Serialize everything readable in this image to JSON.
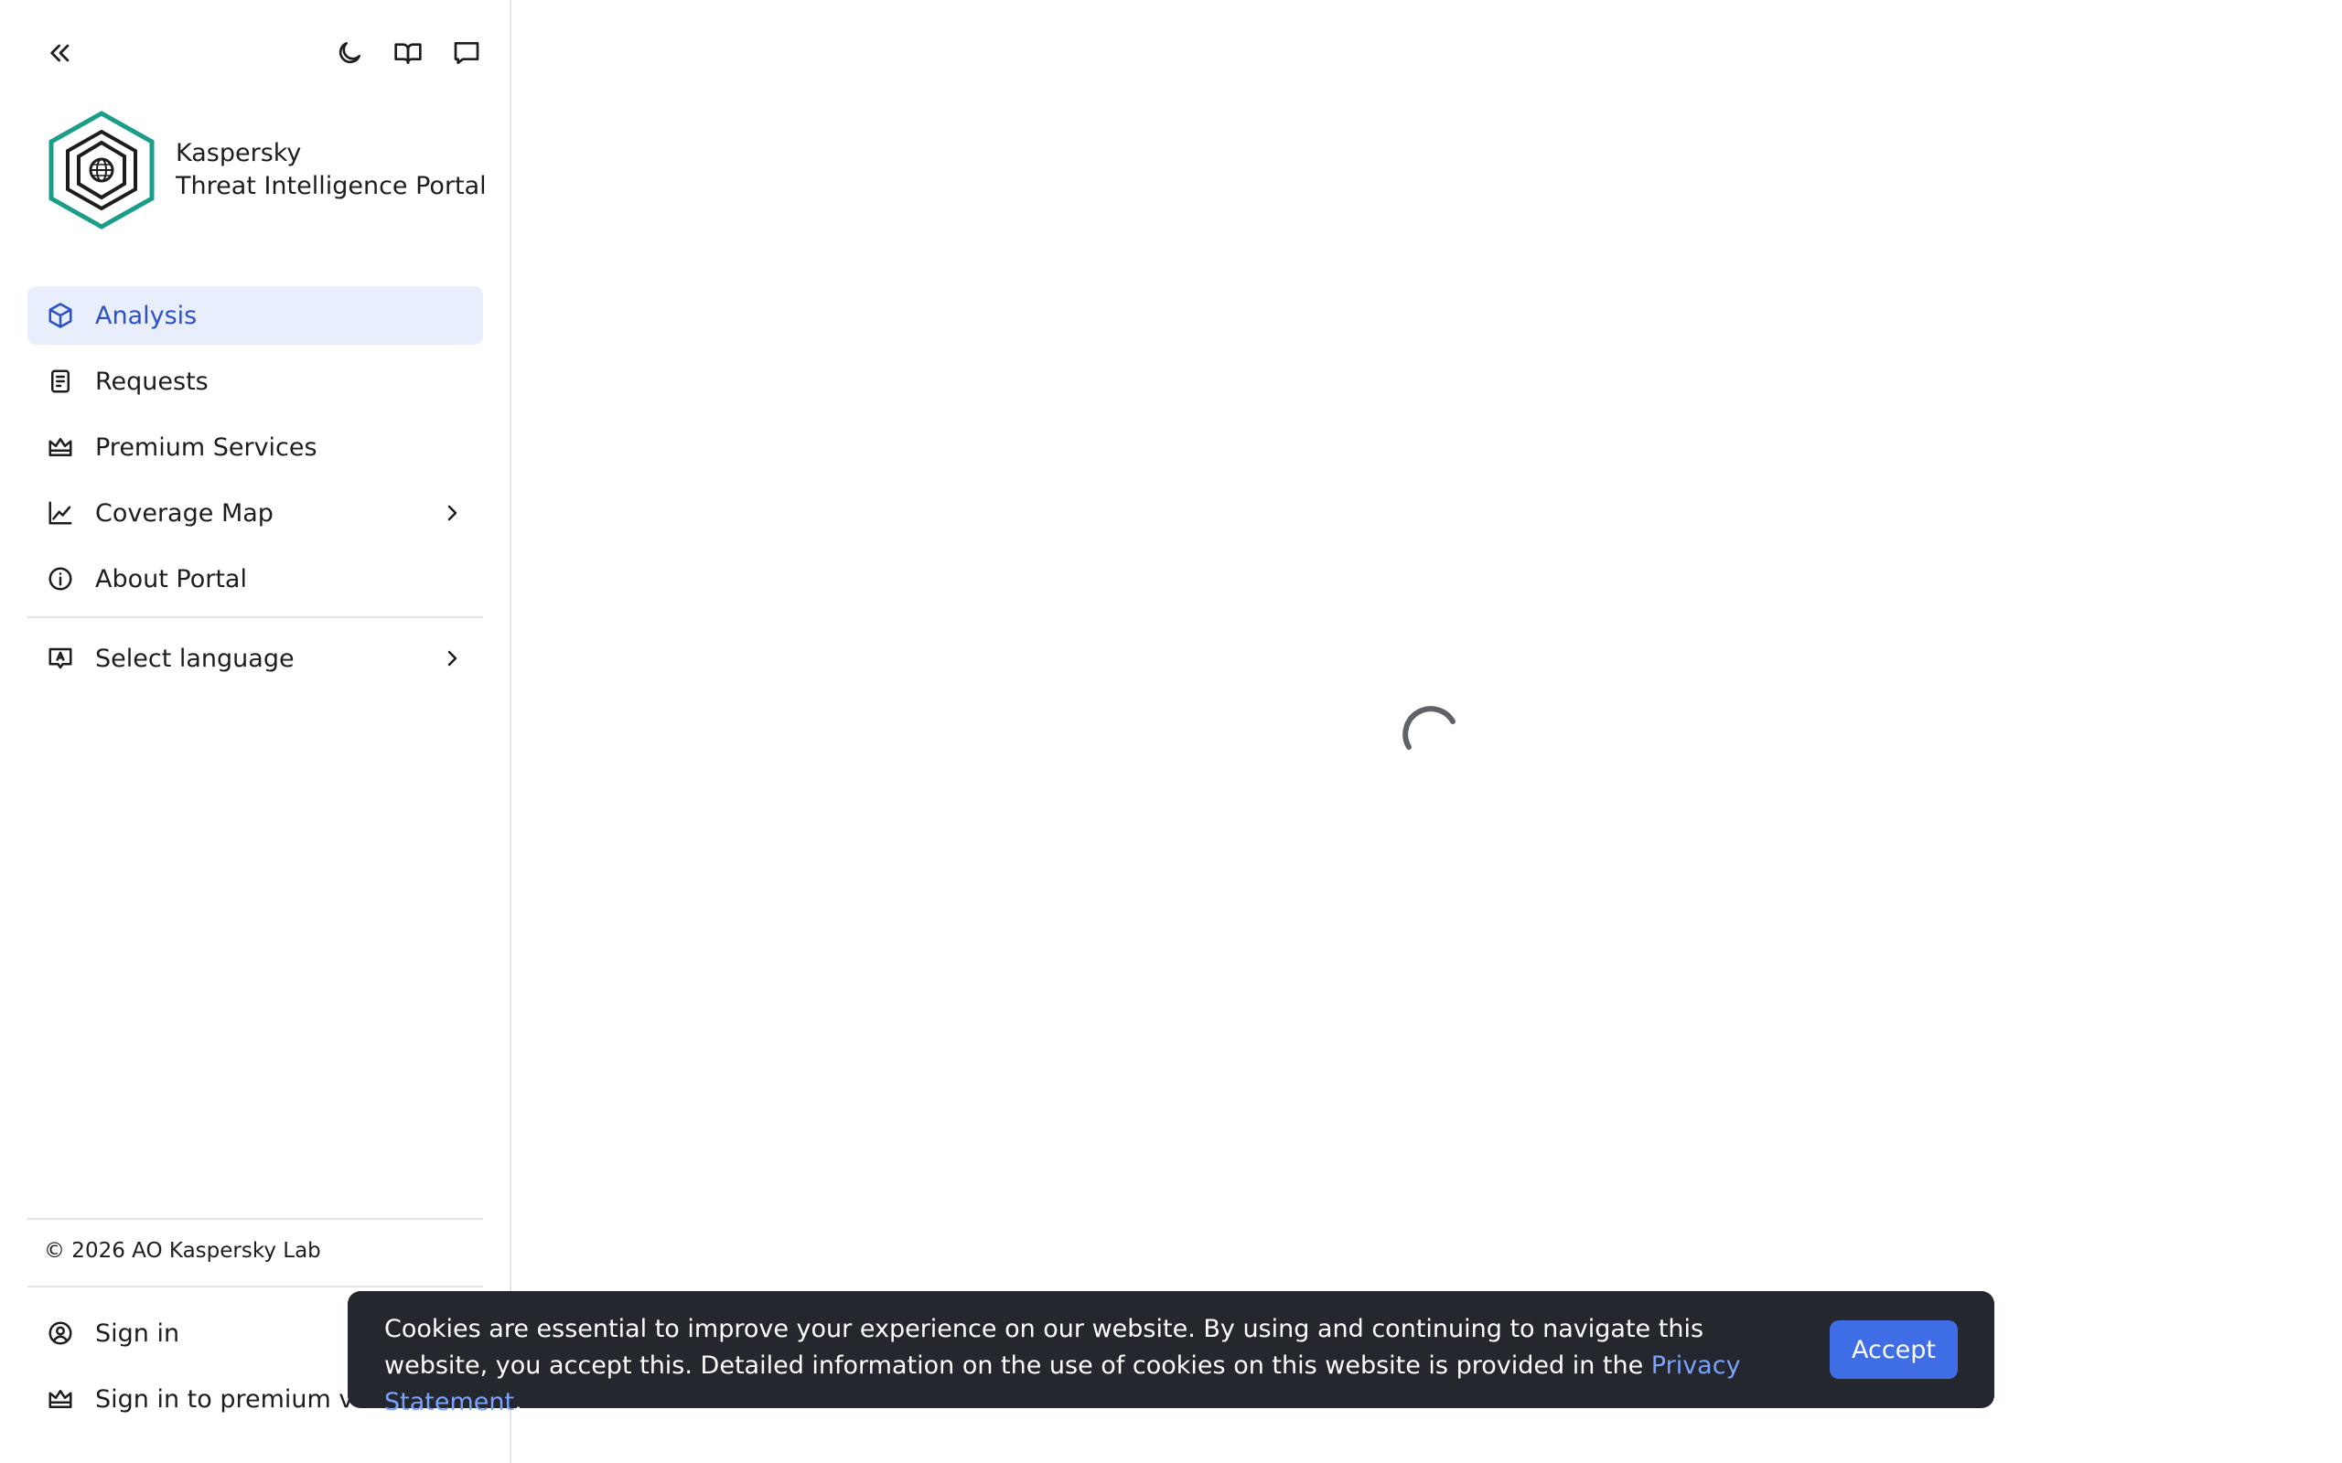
{
  "brand": {
    "line1": "Kaspersky",
    "line2": "Threat Intelligence Portal",
    "color": "#1a9e8a"
  },
  "top_icons": [
    "collapse-icon",
    "moon-icon",
    "book-icon",
    "chat-icon"
  ],
  "nav": {
    "items": [
      {
        "label": "Analysis",
        "icon": "cube-icon",
        "active": true
      },
      {
        "label": "Requests",
        "icon": "document-icon"
      },
      {
        "label": "Premium Services",
        "icon": "crown-icon"
      },
      {
        "label": "Coverage Map",
        "icon": "chart-line-icon",
        "has_chevron": true
      },
      {
        "label": "About Portal",
        "icon": "info-icon"
      }
    ],
    "language": {
      "label": "Select language",
      "icon": "language-icon",
      "has_chevron": true
    }
  },
  "footer": {
    "copyright": "© 2026 AO Kaspersky Lab",
    "sign_in": "Sign in",
    "sign_in_premium": "Sign in to premium ver"
  },
  "cookie": {
    "text_part1": "Cookies are essential to improve your experience on our website. By using and continuing to navigate this website, you accept this. Detailed information on the use of cookies on this website is provided in the ",
    "link_text": "Privacy Statement",
    "text_end": ".",
    "accept_label": "Accept"
  },
  "colors": {
    "accent": "#3f6de6",
    "active_bg": "#e8eefb",
    "active_text": "#2b50c8",
    "banner_bg": "#25272e"
  }
}
